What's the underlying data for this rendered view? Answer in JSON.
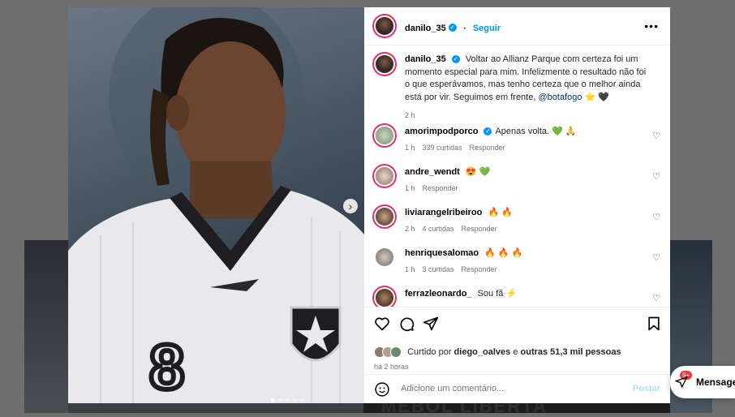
{
  "header": {
    "username": "danilo_35",
    "separator": "•",
    "follow_label": "Seguir"
  },
  "caption": {
    "username": "danilo_35",
    "text": "Voltar ao Allianz Parque com certeza foi um momento especial para mim. Infelizmente o resultado não foi o que esperávamos, mas tenho certeza que o melhor ainda está por vir. Seguimos em frente,",
    "mention": "@botafogo",
    "emojis": "⭐ 🖤",
    "time": "2 h"
  },
  "comments": [
    {
      "username": "amorimpodporco",
      "verified": true,
      "text": "Apenas volta. 💚 🙏",
      "time": "1 h",
      "likes": "339 curtidas",
      "reply": "Responder"
    },
    {
      "username": "andre_wendt",
      "verified": false,
      "text": "😍 💚",
      "time": "1 h",
      "likes": "",
      "reply": "Responder"
    },
    {
      "username": "liviarangelribeiroo",
      "verified": false,
      "text": "🔥 🔥",
      "time": "2 h",
      "likes": "4 curtidas",
      "reply": "Responder"
    },
    {
      "username": "henriquesalomao",
      "verified": false,
      "text": "🔥 🔥 🔥",
      "time": "1 h",
      "likes": "3 curtidas",
      "reply": "Responder"
    },
    {
      "username": "ferrazleonardo_",
      "verified": false,
      "text": "Sou fã ⚡",
      "time": "",
      "likes": "",
      "reply": ""
    }
  ],
  "likes": {
    "prefix": "Curtido por",
    "user": "diego_oalves",
    "conj": "e",
    "others": "outras 51,3 mil pessoas"
  },
  "post_time": "há 2 horas",
  "add_comment": {
    "placeholder": "Adicione um comentário...",
    "post_label": "Postar"
  },
  "messages": {
    "label": "Mensage",
    "badge": "9+"
  },
  "media": {
    "jersey_number": "8",
    "carousel_dots": 5,
    "active_dot": 0
  },
  "background": {
    "text": "MEBOL LIBERTA"
  }
}
